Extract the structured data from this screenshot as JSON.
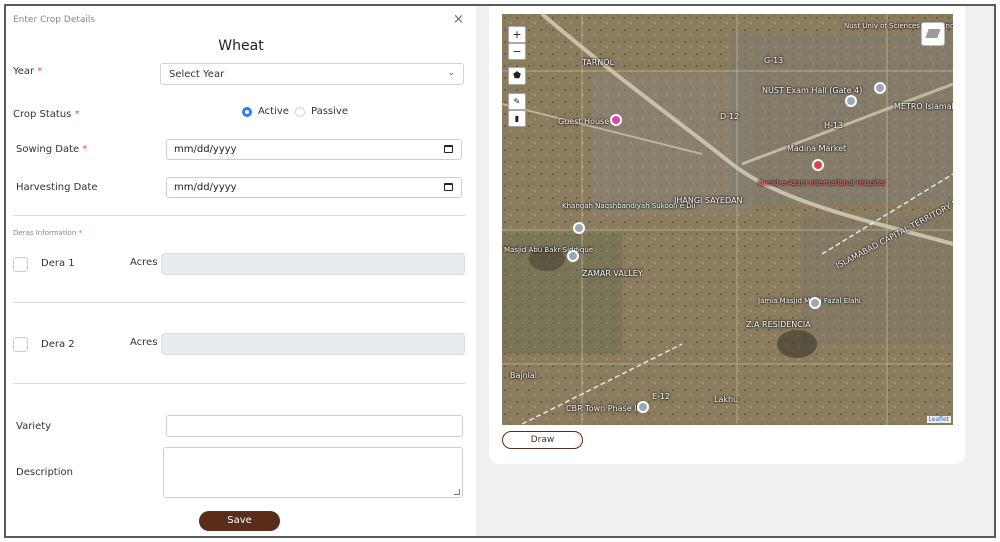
{
  "form": {
    "header": "Enter Crop Details",
    "close_glyph": "×",
    "crop_name": "Wheat",
    "year": {
      "label": "Year",
      "required": "*",
      "value": "Select Year"
    },
    "crop_status": {
      "label": "Crop Status",
      "required": "*",
      "options": [
        {
          "label": "Active",
          "selected": true
        },
        {
          "label": "Passive",
          "selected": false
        }
      ]
    },
    "sowing_date": {
      "label": "Sowing Date",
      "required": "*",
      "value": "mm/dd/yyyy"
    },
    "harvesting_date": {
      "label": "Harvesting Date",
      "value": "mm/dd/yyyy"
    },
    "deras": {
      "label": "Deras Information",
      "required": "*",
      "items": [
        {
          "name": "Dera 1",
          "acres_label": "Acres",
          "checked": false
        },
        {
          "name": "Dera 2",
          "acres_label": "Acres",
          "checked": false
        }
      ]
    },
    "variety": {
      "label": "Variety",
      "value": ""
    },
    "description": {
      "label": "Description",
      "value": ""
    },
    "save_label": "Save"
  },
  "map": {
    "zoom_in": "+",
    "zoom_out": "−",
    "attribution": "Leaflet",
    "labels": [
      "TARNOL",
      "G-13",
      "NUST Exam Hall (Gate 4)",
      "Nust Univ of Sciences & Technology",
      "H-13",
      "METRO Islamabad",
      "Guest House",
      "Madina Market",
      "Quaid-e-Azam International Hospital",
      "Khangah Naqshbandiyah Sukoon e Dil",
      "JHANGI SAYEDAN",
      "ISLAMABAD CAPITAL TERRITORY PUNJAB",
      "ZAMAR VALLEY",
      "Masjid Abu Bakr Siddique",
      "Jamia Masjid Mufti Fazal Elahi",
      "Z.A RESIDENCIA",
      "Bajnial",
      "CBR Town Phase II",
      "Lakhu",
      "D-12",
      "E-12"
    ],
    "draw_label": "Draw"
  },
  "colors": {
    "brand_brown": "#5a2c1a",
    "radio_blue": "#2f7cf6",
    "required_red": "#d9534f"
  },
  "icons": [
    "close-icon",
    "chevron-down-icon",
    "calendar-icon",
    "zoom-in-icon",
    "zoom-out-icon",
    "polygon-icon",
    "edit-icon",
    "trash-icon",
    "layers-icon",
    "map-pin-icon"
  ]
}
